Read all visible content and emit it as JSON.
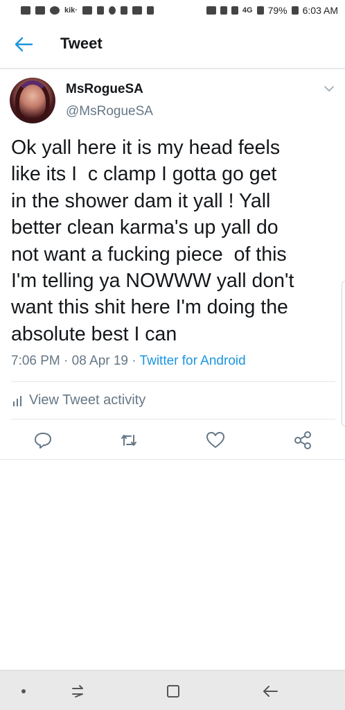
{
  "status_bar": {
    "kik_label": "kik·",
    "network_label": "4G",
    "battery": "79%",
    "time": "6:03 AM"
  },
  "header": {
    "title": "Tweet",
    "back_icon": "arrow-left-icon"
  },
  "tweet": {
    "author_name": "MsRogueSA",
    "author_handle": "@MsRogueSA",
    "text": "Ok yall here it is my head feels\nlike its I  c clamp I gotta go get\nin the shower dam it yall ! Yall\nbetter clean karma's up yall do\nnot want a fucking piece  of this\nI'm telling ya NOWWW yall don't\nwant this shit here I'm doing the\nabsolute best I can",
    "time": "7:06 PM",
    "date": "08 Apr 19",
    "separator": "·",
    "client": "Twitter for Android",
    "activity_label": "View Tweet activity"
  },
  "actions": [
    "reply-icon",
    "retweet-icon",
    "like-icon",
    "share-icon"
  ],
  "colors": {
    "accent": "#1b95e0",
    "secondary_text": "#657786",
    "primary_text": "#14171a"
  },
  "nav_bar": [
    "recents-icon",
    "home-icon",
    "back-icon"
  ]
}
